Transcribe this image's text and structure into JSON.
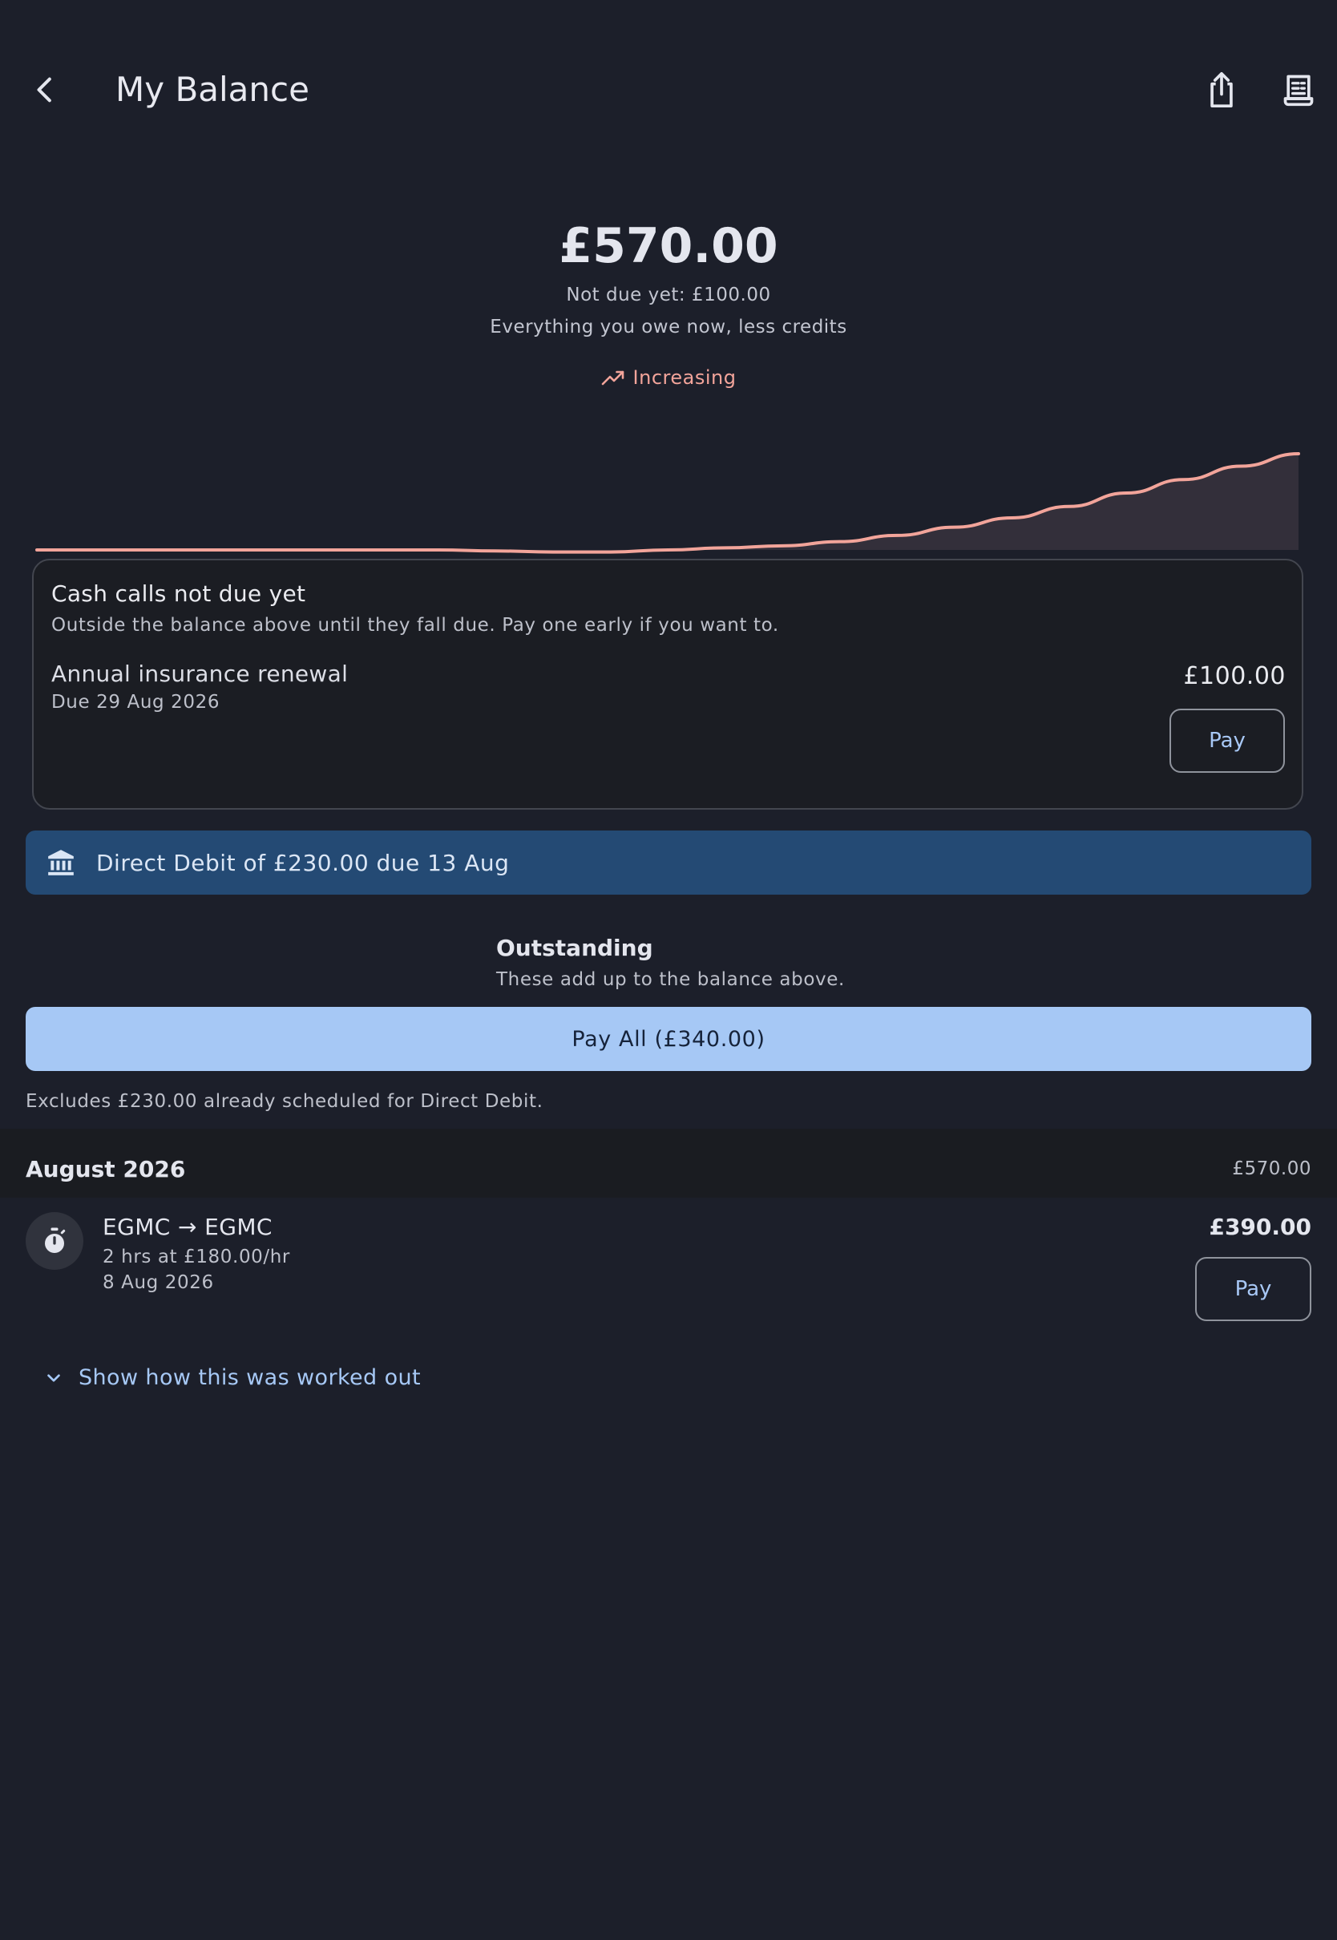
{
  "header": {
    "title": "My Balance",
    "back_icon": "chevron-left-icon",
    "share_icon": "share-icon",
    "receipt_icon": "receipt-icon"
  },
  "balance": {
    "amount": "£570.00",
    "not_due": "Not due yet: £100.00",
    "description": "Everything you owe now, less credits",
    "trend_label": "Increasing",
    "trend_icon": "trending-up-icon"
  },
  "sparkline": {
    "trend": "increasing",
    "values": [
      0,
      0,
      0,
      0,
      0,
      0,
      0,
      0,
      -1,
      -2,
      -2,
      0,
      2,
      4,
      8,
      14,
      22,
      31,
      42,
      55,
      68,
      81,
      93
    ]
  },
  "cash_calls": {
    "title": "Cash calls not due yet",
    "subtitle": "Outside the balance above until they fall due. Pay one early if you want to.",
    "items": [
      {
        "name": "Annual insurance renewal",
        "due": "Due 29 Aug 2026",
        "amount": "£100.00",
        "pay_label": "Pay"
      }
    ]
  },
  "direct_debit": {
    "icon": "bank-icon",
    "text": "Direct Debit of £230.00 due 13 Aug"
  },
  "outstanding": {
    "title": "Outstanding",
    "subtitle": "These add up to the balance above.",
    "pay_all_label": "Pay All (£340.00)",
    "excludes_note": "Excludes £230.00 already scheduled for Direct Debit."
  },
  "months": [
    {
      "label": "August 2026",
      "total": "£570.00",
      "transactions": [
        {
          "icon": "timer-icon",
          "title": "EGMC → EGMC",
          "detail": "2 hrs at £180.00/hr",
          "date": "8 Aug 2026",
          "amount": "£390.00",
          "pay_label": "Pay"
        }
      ]
    }
  ],
  "show_details": {
    "label": "Show how this was worked out",
    "icon": "chevron-down-icon"
  },
  "colors": {
    "background": "#1c1f2a",
    "accent": "#a6c8f5",
    "trend": "#f2a49a",
    "direct_debit_bg": "#244a74"
  }
}
